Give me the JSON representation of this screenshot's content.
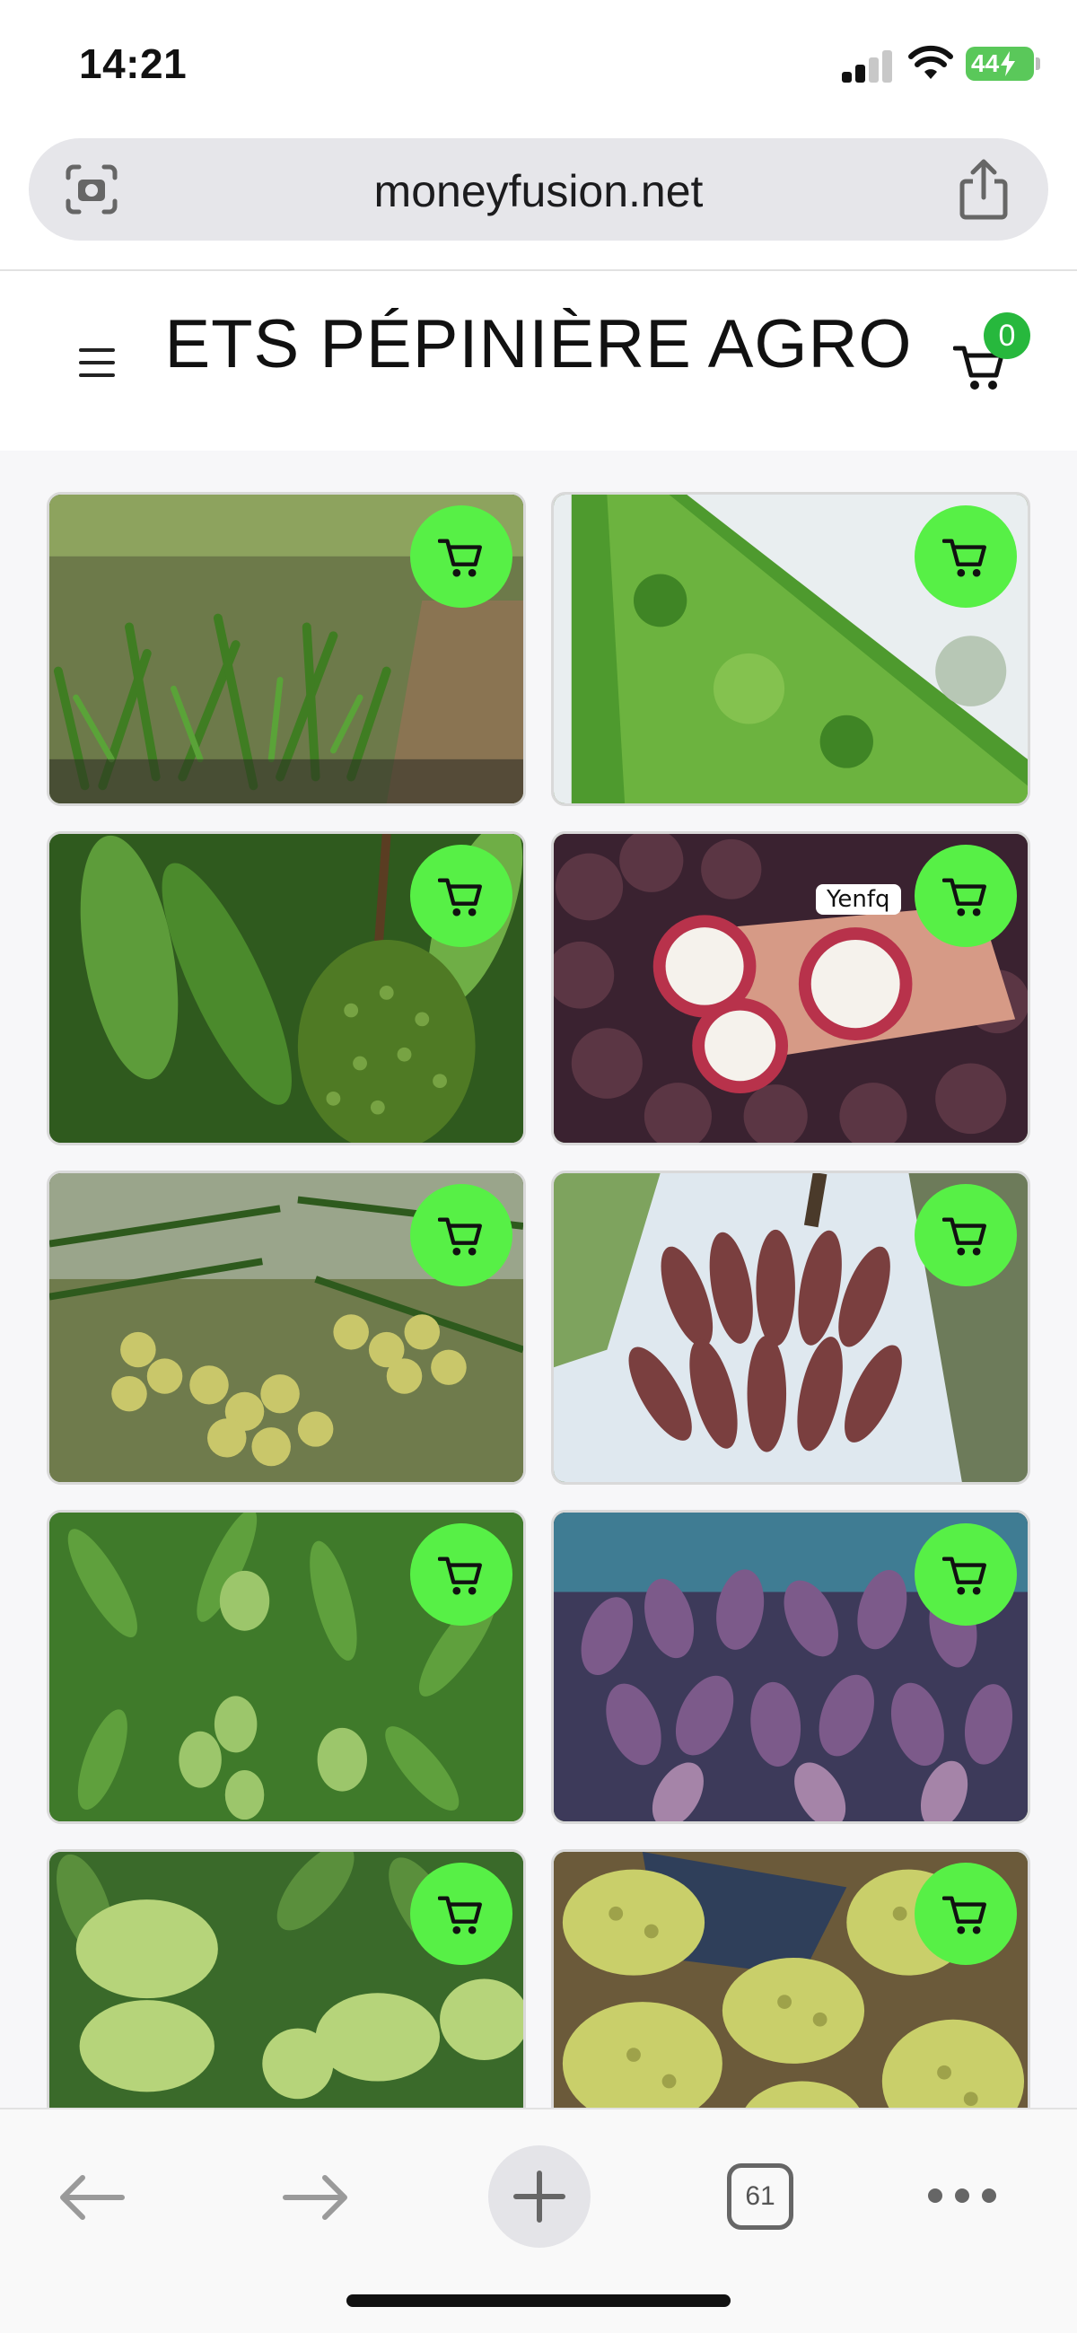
{
  "status_bar": {
    "time": "14:21",
    "battery": "44"
  },
  "browser": {
    "url": "moneyfusion.net",
    "open_tabs": "61"
  },
  "site": {
    "title": "ETS PÉPINIÈRE AGRO",
    "cart_count": "0"
  },
  "products": [
    {
      "image": "palm-seedlings-photo"
    },
    {
      "image": "green-hedge-photo"
    },
    {
      "image": "soursop-photo"
    },
    {
      "image": "mangosteen-photo",
      "overlay_text": "Yenfq"
    },
    {
      "image": "date-palm-fruit-photo"
    },
    {
      "image": "red-banana-photo"
    },
    {
      "image": "mango-tree-photo"
    },
    {
      "image": "purple-safou-photo"
    },
    {
      "image": "guava-photo"
    },
    {
      "image": "custard-apple-photo"
    }
  ],
  "colors": {
    "accent_green": "#57f046",
    "badge_green": "#27b83d",
    "battery_green": "#5ac85a",
    "url_bar_bg": "#e6e6ea"
  }
}
